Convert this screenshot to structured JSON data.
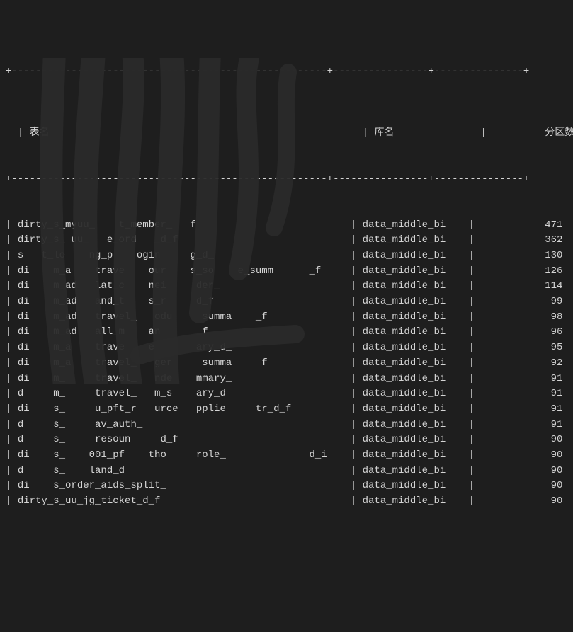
{
  "headers": {
    "name": "表名",
    "db": "库名",
    "partitions": "分区数"
  },
  "divider_top": "+-----------------------------------------------------+----------------+---------------+",
  "divider_mid": "+-----------------------------------------------------+----------------+---------------+",
  "rows": [
    {
      "name": "dirty_s_myuu_    t_member_   f",
      "db": "data_middle_bi",
      "partitions": "471"
    },
    {
      "name": "dirty_s_ uu_   e_ord   _d_f",
      "db": "data_middle_bi",
      "partitions": "362"
    },
    {
      "name": "s   t_lo    ng_p    ogin     g_d_",
      "db": "data_middle_bi",
      "partitions": "130"
    },
    {
      "name": "di    m_a    trave    our    s_so    e_summ      _f",
      "db": "data_middle_bi",
      "partitions": "126"
    },
    {
      "name": "di    m_ad   lat_c    nei     der_",
      "db": "data_middle_bi",
      "partitions": "114"
    },
    {
      "name": "di    m_ad   and_t    s_r     d_f",
      "db": "data_middle_bi",
      "partitions": "99"
    },
    {
      "name": "di    m_ad   travel_   odu     summa    _f",
      "db": "data_middle_bi",
      "partitions": "98"
    },
    {
      "name": "di    m_ad   all_m    an      _f",
      "db": "data_middle_bi",
      "partitions": "96"
    },
    {
      "name": "di    m_a    trave    e_s     ary_d_",
      "db": "data_middle_bi",
      "partitions": "95"
    },
    {
      "name": "di    m_a    travel_   ger     summa     f",
      "db": "data_middle_bi",
      "partitions": "92"
    },
    {
      "name": "di    m_     travel_   nde    mmary_",
      "db": "data_middle_bi",
      "partitions": "91"
    },
    {
      "name": "d     m_     travel_   m_s    ary_d",
      "db": "data_middle_bi",
      "partitions": "91"
    },
    {
      "name": "di    s_     u_pft_r   urce   pplie     tr_d_f",
      "db": "data_middle_bi",
      "partitions": "91"
    },
    {
      "name": "d     s_     av_auth_",
      "db": "data_middle_bi",
      "partitions": "91"
    },
    {
      "name": "d     s_     resoun     d_f",
      "db": "data_middle_bi",
      "partitions": "90"
    },
    {
      "name": "di    s_    001_pf    tho     role_              d_i",
      "db": "data_middle_bi",
      "partitions": "90"
    },
    {
      "name": "d     s_    land_d",
      "db": "data_middle_bi",
      "partitions": "90"
    },
    {
      "name": "di    s_order_aids_split_",
      "db": "data_middle_bi",
      "partitions": "90"
    },
    {
      "name": "dirty_s_uu_jg_ticket_d_f",
      "db": "data_middle_bi",
      "partitions": "90"
    }
  ]
}
